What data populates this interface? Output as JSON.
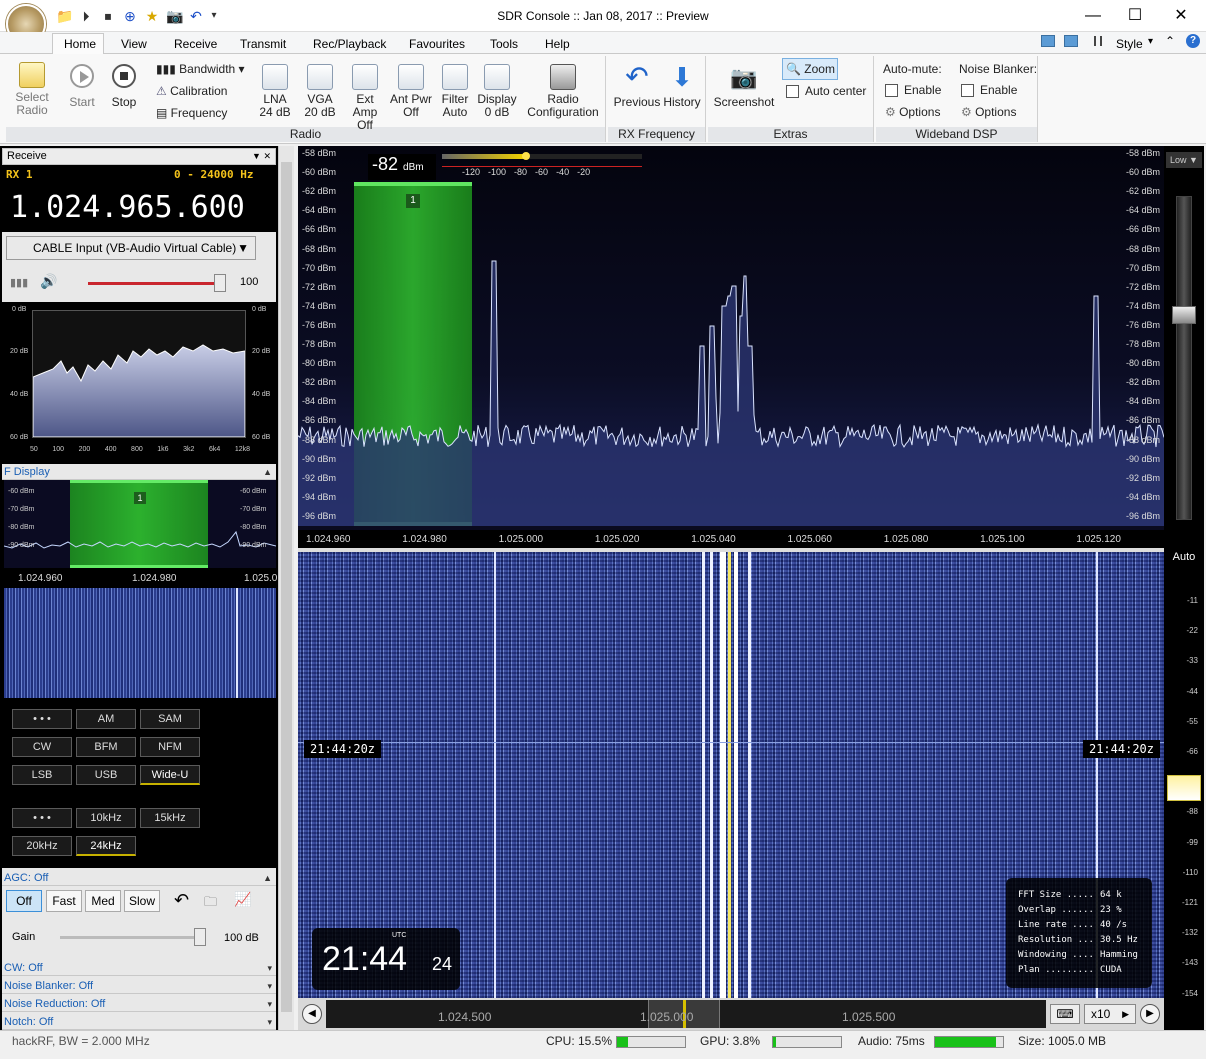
{
  "title": "SDR Console :: Jan 08, 2017 :: Preview",
  "menu": [
    "Home",
    "View",
    "Receive",
    "Transmit",
    "Rec/Playback",
    "Favourites",
    "Tools",
    "Help"
  ],
  "style_label": "Style",
  "ribbon": {
    "select_radio": [
      "Select",
      "Radio"
    ],
    "start": "Start",
    "stop": "Stop",
    "bandwidth": "Bandwidth",
    "calibration": "Calibration",
    "frequency": "Frequency",
    "lna": [
      "LNA",
      "24 dB"
    ],
    "vga": [
      "VGA",
      "20 dB"
    ],
    "ext_amp": [
      "Ext Amp",
      "Off"
    ],
    "ant_pwr": [
      "Ant Pwr",
      "Off"
    ],
    "filter": [
      "Filter",
      "Auto"
    ],
    "display": [
      "Display",
      "0 dB"
    ],
    "radio_config": [
      "Radio",
      "Configuration"
    ],
    "group_radio": "Radio",
    "previous": "Previous",
    "history": "History",
    "group_rxfreq": "RX Frequency",
    "screenshot": "Screenshot",
    "zoom": "Zoom",
    "auto_center": "Auto center",
    "group_extras": "Extras",
    "auto_mute": "Auto-mute:",
    "noise_blanker": "Noise Blanker:",
    "enable": "Enable",
    "options": "Options",
    "group_wdsp": "Wideband DSP"
  },
  "receive": {
    "header": "Receive",
    "rx_label": "RX 1",
    "range": "0 - 24000 Hz",
    "frequency": "1.024.965.600",
    "input_device": "CABLE Input (VB-Audio Virtual Cable)",
    "volume": "100",
    "audio_db_labels": [
      "0 dB",
      "20 dB",
      "40 dB",
      "60 dB"
    ],
    "audio_x_labels": [
      "50",
      "100",
      "200",
      "400",
      "800",
      "1k6",
      "3k2",
      "6k4",
      "12k8"
    ]
  },
  "if_display": {
    "header": "F Display",
    "db_labels": [
      "-60 dBm",
      "-70 dBm",
      "-80 dBm",
      "-90 dBm"
    ],
    "freq_labels": [
      "1.024.960",
      "1.024.980",
      "1.025.0"
    ],
    "marker": "1"
  },
  "modes": [
    [
      "• • •",
      "AM",
      "SAM"
    ],
    [
      "CW",
      "BFM",
      "NFM"
    ],
    [
      "LSB",
      "USB",
      "Wide-U"
    ]
  ],
  "bandwidths": [
    [
      "• • •",
      "10kHz",
      "15kHz"
    ],
    [
      "20kHz",
      "24kHz"
    ]
  ],
  "selected_mode": "Wide-U",
  "selected_bw": "24kHz",
  "agc": {
    "header": "AGC: Off",
    "buttons": [
      "Off",
      "Fast",
      "Med",
      "Slow"
    ],
    "gain_label": "Gain",
    "gain_value": "100 dB"
  },
  "panels": [
    "CW: Off",
    "Noise Blanker: Off",
    "Noise Reduction: Off",
    "Notch: Off"
  ],
  "spectrum": {
    "signal_level": "-82",
    "signal_unit": "dBm",
    "meter_scale": [
      "-120",
      "-100",
      "-80",
      "-60",
      "-40",
      "-20"
    ],
    "db_labels": [
      "-58 dBm",
      "-60 dBm",
      "-62 dBm",
      "-64 dBm",
      "-66 dBm",
      "-68 dBm",
      "-70 dBm",
      "-72 dBm",
      "-74 dBm",
      "-76 dBm",
      "-78 dBm",
      "-80 dBm",
      "-82 dBm",
      "-84 dBm",
      "-86 dBm",
      "-88 dBm",
      "-90 dBm",
      "-92 dBm",
      "-94 dBm",
      "-96 dBm"
    ],
    "freq_labels": [
      "1.024.960",
      "1.024.980",
      "1.025.000",
      "1.025.020",
      "1.025.040",
      "1.025.060",
      "1.025.080",
      "1.025.100",
      "1.025.120"
    ],
    "marker": "1",
    "level_label": "Low"
  },
  "waterfall": {
    "time_tag": "21:44:20z",
    "clock_hm": "21:44",
    "clock_s": "24",
    "clock_utc": "UTC",
    "info": [
      [
        "FFT Size .....",
        "64 k"
      ],
      [
        "Overlap ......",
        "23 %"
      ],
      [
        "Line rate ....",
        "40 /s"
      ],
      [
        "Resolution ...",
        "30.5 Hz"
      ],
      [
        "Windowing ....",
        "Hamming"
      ],
      [
        "Plan .........",
        "CUDA"
      ]
    ],
    "scroll_labels": [
      "1.024.500",
      "1.025.000",
      "1.025.500"
    ],
    "zoom": "x10",
    "auto_label": "Auto",
    "scale": [
      "-11",
      "-22",
      "-33",
      "-44",
      "-55",
      "-66",
      "-77",
      "-88",
      "-99",
      "-110",
      "-121",
      "-132",
      "-143",
      "-154"
    ]
  },
  "status": {
    "device": "hackRF, BW = 2.000 MHz",
    "cpu": "CPU: 15.5%",
    "gpu": "GPU: 3.8%",
    "audio": "Audio: 75ms",
    "size": "Size: 1005.0 MB",
    "cpu_level": 0.155,
    "gpu_level": 0.038,
    "audio_level": 0.9
  }
}
